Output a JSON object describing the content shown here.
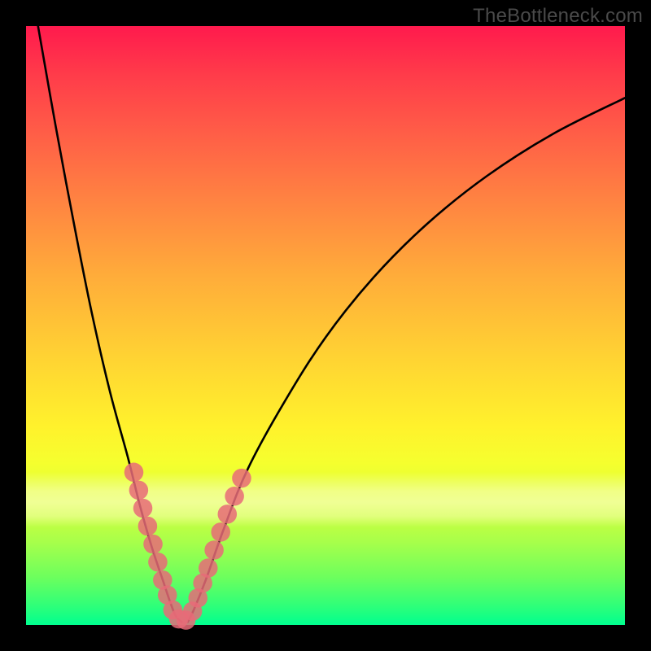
{
  "watermark": "TheBottleneck.com",
  "chart_data": {
    "type": "line",
    "title": "",
    "xlabel": "",
    "ylabel": "",
    "xlim": [
      0,
      100
    ],
    "ylim": [
      0,
      100
    ],
    "grid": false,
    "background_gradient": {
      "direction": "vertical",
      "stops": [
        {
          "pos": 0,
          "color": "#ff1a4d"
        },
        {
          "pos": 30,
          "color": "#ff8641"
        },
        {
          "pos": 55,
          "color": "#ffd233"
        },
        {
          "pos": 73,
          "color": "#f5ff2e"
        },
        {
          "pos": 100,
          "color": "#00ff8f"
        }
      ]
    },
    "highlight_band": {
      "y_from": 74.5,
      "y_to": 83.7,
      "color": "#ffffc8"
    },
    "series": [
      {
        "name": "left-curve",
        "color": "#000000",
        "points": [
          {
            "x": 2.0,
            "y": 0.0
          },
          {
            "x": 5.0,
            "y": 17.0
          },
          {
            "x": 8.0,
            "y": 33.0
          },
          {
            "x": 11.0,
            "y": 48.0
          },
          {
            "x": 14.0,
            "y": 61.0
          },
          {
            "x": 17.0,
            "y": 72.0
          },
          {
            "x": 19.0,
            "y": 80.0
          },
          {
            "x": 21.0,
            "y": 87.0
          },
          {
            "x": 23.0,
            "y": 93.0
          },
          {
            "x": 24.0,
            "y": 96.0
          },
          {
            "x": 25.0,
            "y": 98.5
          },
          {
            "x": 26.0,
            "y": 99.5
          }
        ]
      },
      {
        "name": "right-curve",
        "color": "#000000",
        "points": [
          {
            "x": 27.0,
            "y": 99.5
          },
          {
            "x": 28.0,
            "y": 97.5
          },
          {
            "x": 30.0,
            "y": 92.5
          },
          {
            "x": 33.0,
            "y": 84.0
          },
          {
            "x": 37.0,
            "y": 74.0
          },
          {
            "x": 43.0,
            "y": 63.0
          },
          {
            "x": 50.0,
            "y": 52.0
          },
          {
            "x": 58.0,
            "y": 42.0
          },
          {
            "x": 67.0,
            "y": 33.0
          },
          {
            "x": 77.0,
            "y": 25.0
          },
          {
            "x": 88.0,
            "y": 18.0
          },
          {
            "x": 100.0,
            "y": 12.0
          }
        ]
      }
    ],
    "dot_overlay": {
      "color": "#e86b78",
      "radius_units": 1.6,
      "points": [
        {
          "x": 18.0,
          "y": 74.5
        },
        {
          "x": 18.8,
          "y": 77.5
        },
        {
          "x": 19.5,
          "y": 80.5
        },
        {
          "x": 20.3,
          "y": 83.5
        },
        {
          "x": 21.2,
          "y": 86.5
        },
        {
          "x": 22.0,
          "y": 89.5
        },
        {
          "x": 22.8,
          "y": 92.5
        },
        {
          "x": 23.6,
          "y": 95.0
        },
        {
          "x": 24.5,
          "y": 97.5
        },
        {
          "x": 25.5,
          "y": 99.0
        },
        {
          "x": 26.7,
          "y": 99.2
        },
        {
          "x": 27.8,
          "y": 97.7
        },
        {
          "x": 28.7,
          "y": 95.5
        },
        {
          "x": 29.5,
          "y": 93.0
        },
        {
          "x": 30.4,
          "y": 90.5
        },
        {
          "x": 31.4,
          "y": 87.5
        },
        {
          "x": 32.5,
          "y": 84.5
        },
        {
          "x": 33.6,
          "y": 81.5
        },
        {
          "x": 34.8,
          "y": 78.5
        },
        {
          "x": 36.0,
          "y": 75.5
        }
      ]
    }
  }
}
